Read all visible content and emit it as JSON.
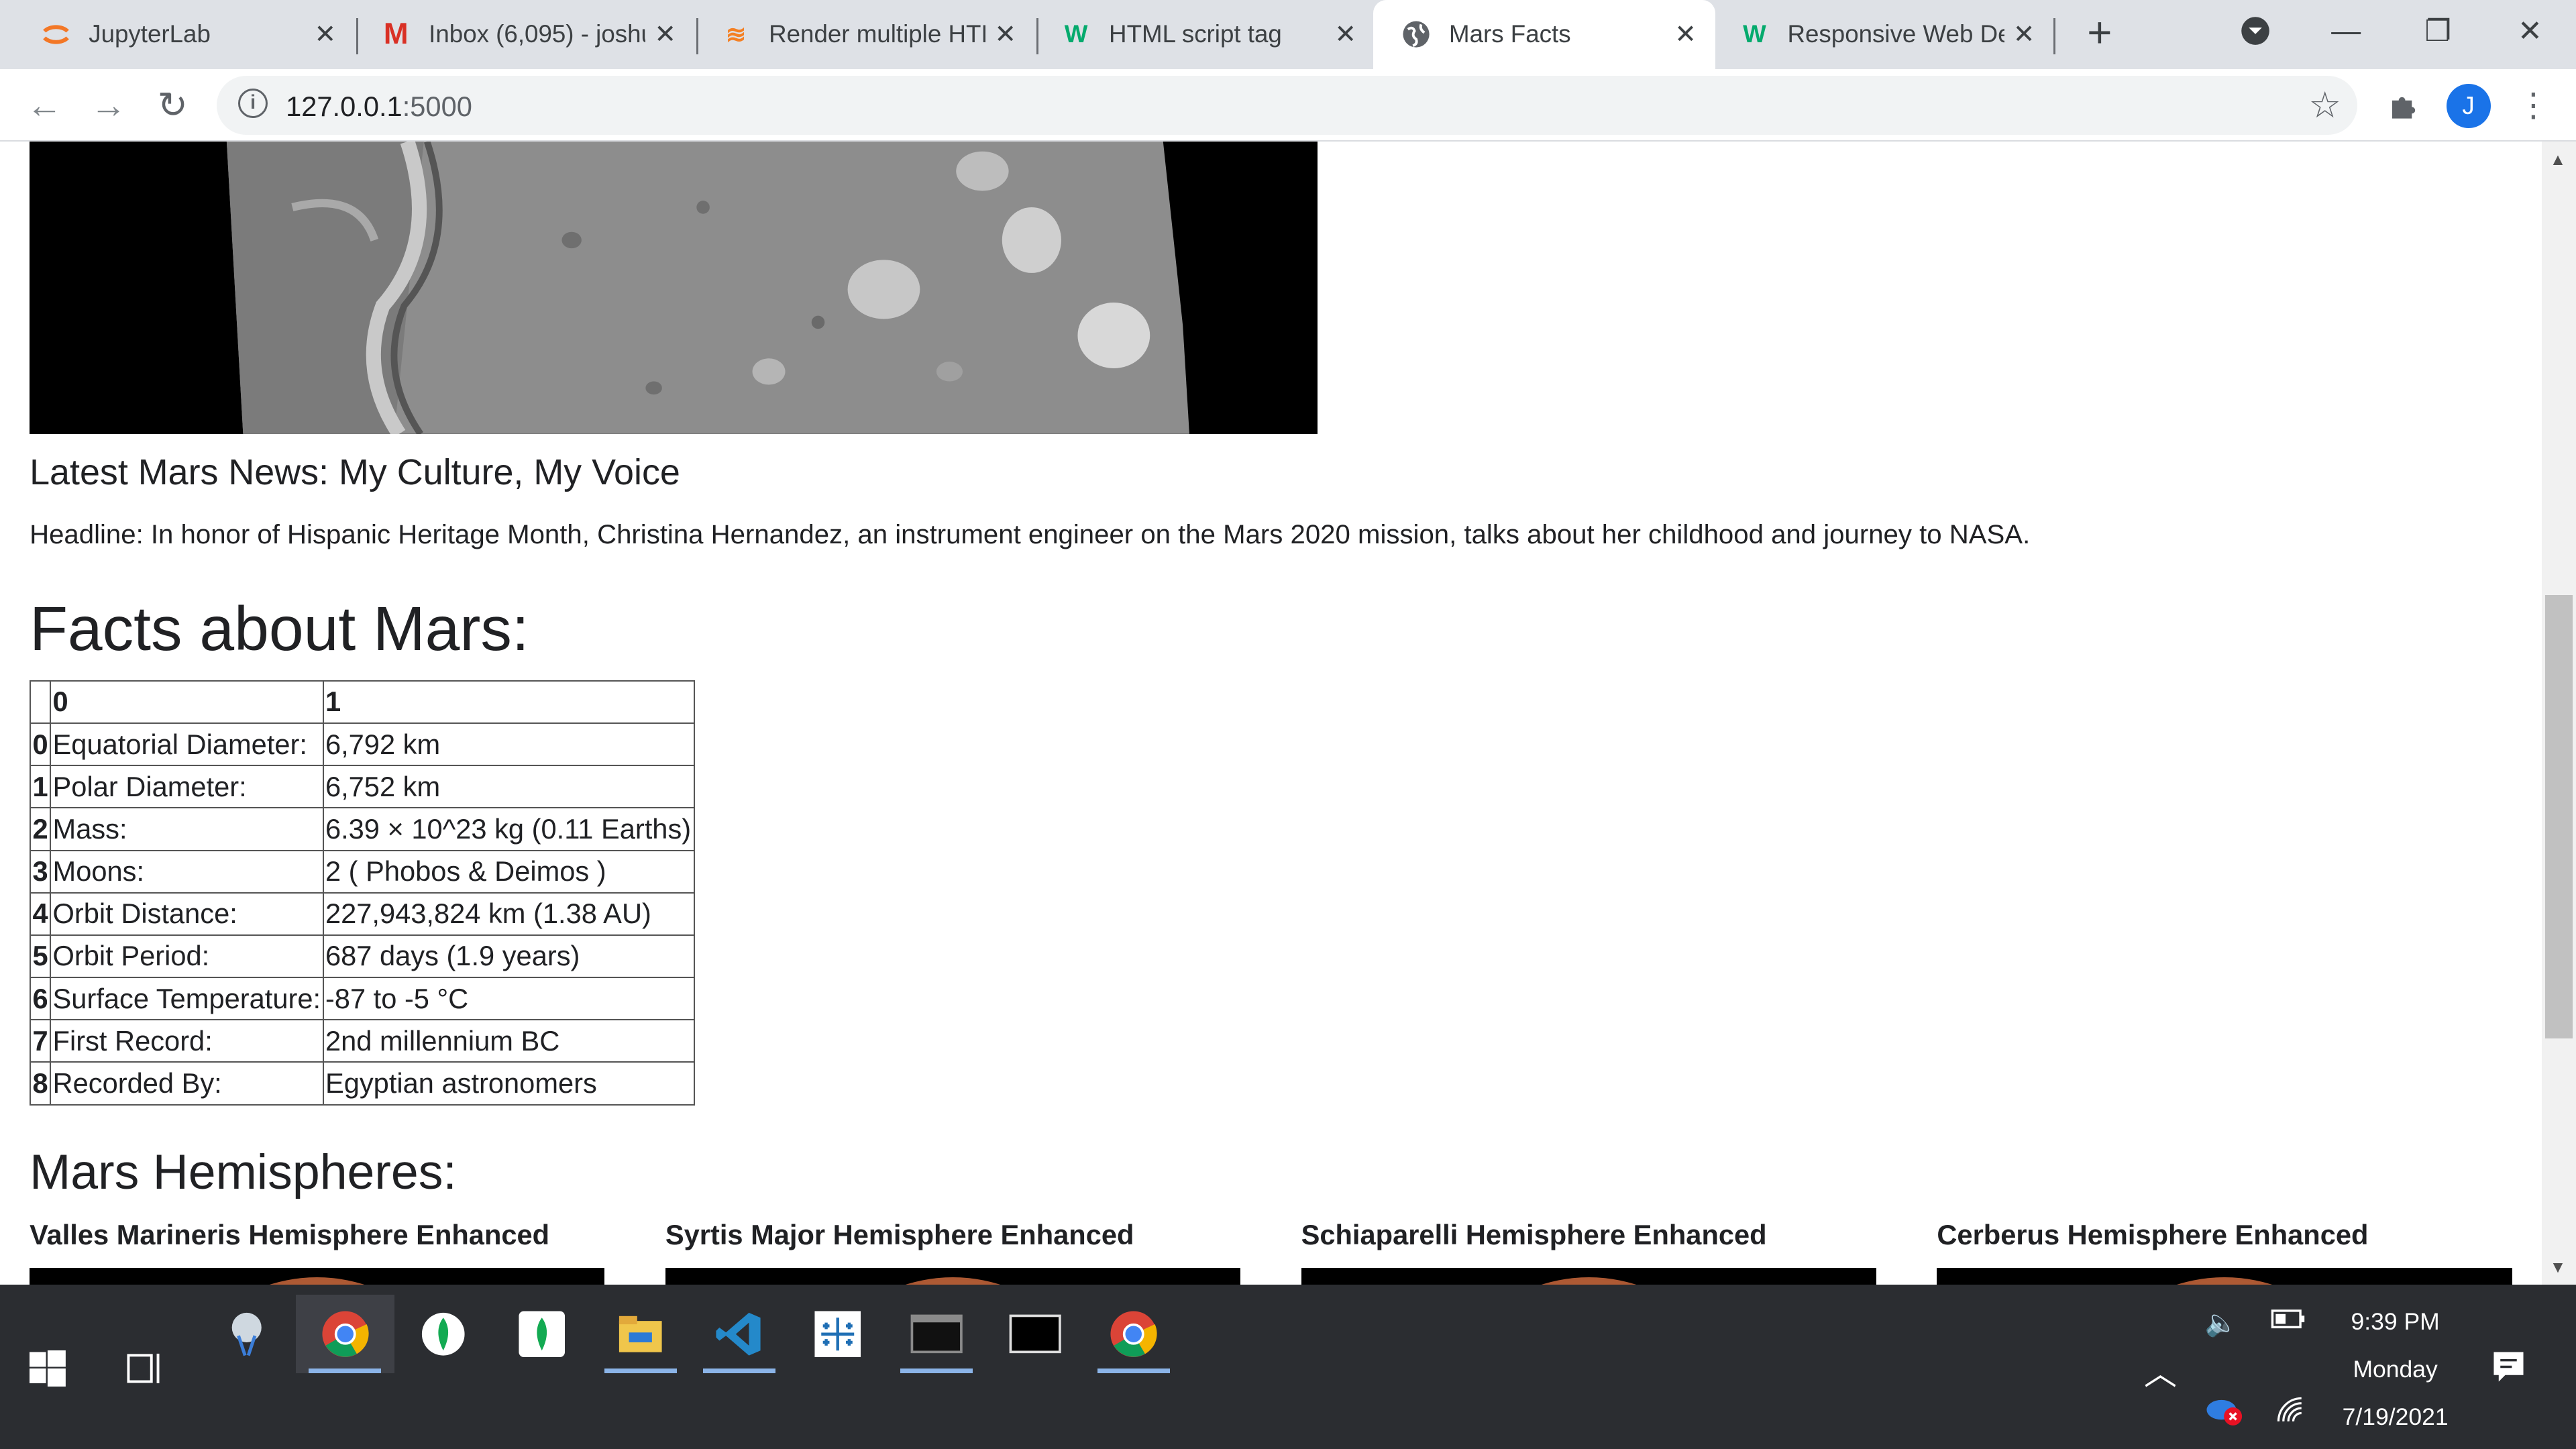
{
  "tabs": [
    {
      "title": "JupyterLab",
      "icon": "jupyter-icon"
    },
    {
      "title": "Inbox (6,095) - joshu",
      "icon": "gmail-icon"
    },
    {
      "title": "Render multiple HTI",
      "icon": "stackoverflow-icon"
    },
    {
      "title": "HTML script tag",
      "icon": "w3schools-icon"
    },
    {
      "title": "Mars Facts",
      "icon": "globe-icon"
    },
    {
      "title": "Responsive Web De",
      "icon": "w3schools-icon"
    }
  ],
  "window": {
    "new_tab": "+",
    "minimize": "—",
    "restore": "❐",
    "close": "✕"
  },
  "omnibox": {
    "host": "127.0.0.1",
    "port": ":5000"
  },
  "profile": {
    "initial": "J"
  },
  "news": {
    "title": "Latest Mars News: My Culture, My Voice",
    "headline": "Headline: In honor of Hispanic Heritage Month, Christina Hernandez, an instrument engineer on the Mars 2020 mission, talks about her childhood and journey to NASA."
  },
  "facts": {
    "title": "Facts about Mars:",
    "header": [
      "",
      "0",
      "1"
    ],
    "rows": [
      {
        "idx": "0",
        "label": "Equatorial Diameter:",
        "value": "6,792 km"
      },
      {
        "idx": "1",
        "label": "Polar Diameter:",
        "value": "6,752 km"
      },
      {
        "idx": "2",
        "label": "Mass:",
        "value": "6.39 × 10^23 kg (0.11 Earths)"
      },
      {
        "idx": "3",
        "label": "Moons:",
        "value": "2 ( Phobos & Deimos )"
      },
      {
        "idx": "4",
        "label": "Orbit Distance:",
        "value": "227,943,824 km (1.38 AU)"
      },
      {
        "idx": "5",
        "label": "Orbit Period:",
        "value": "687 days (1.9 years)"
      },
      {
        "idx": "6",
        "label": "Surface Temperature:",
        "value": "-87 to -5 °C"
      },
      {
        "idx": "7",
        "label": "First Record:",
        "value": "2nd millennium BC"
      },
      {
        "idx": "8",
        "label": "Recorded By:",
        "value": "Egyptian astronomers"
      }
    ]
  },
  "hemispheres": {
    "title": "Mars Hemispheres:",
    "items": [
      "Valles Marineris Hemisphere Enhanced",
      "Syrtis Major Hemisphere Enhanced",
      "Schiaparelli Hemisphere Enhanced",
      "Cerberus Hemisphere Enhanced"
    ]
  },
  "taskbar": {
    "time": "9:39 PM",
    "day": "Monday",
    "date": "7/19/2021"
  },
  "colors": {
    "accent": "#1a73e8",
    "tab_strip": "#dee1e6",
    "taskbar": "#2b2d31"
  }
}
